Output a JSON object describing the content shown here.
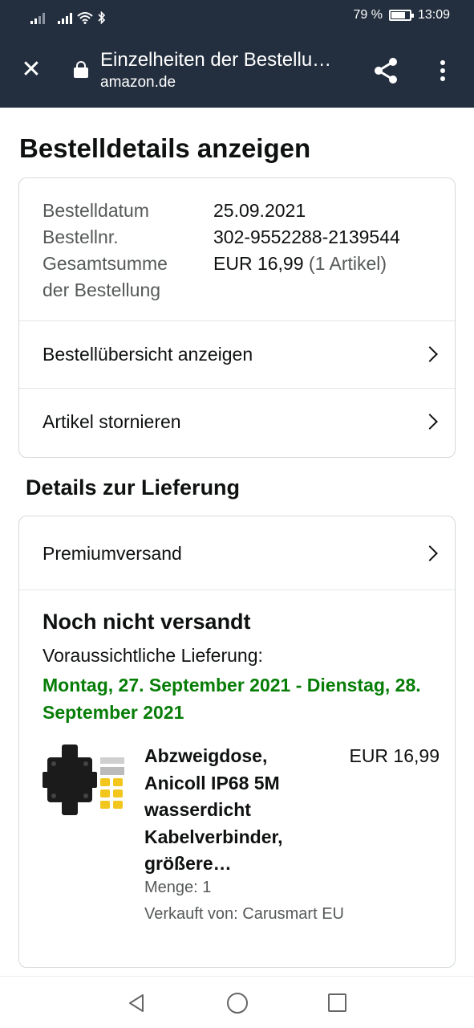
{
  "status_bar": {
    "battery_text": "79 %",
    "battery_level": 0.79,
    "time": "13:09",
    "icons": [
      "signal-icon",
      "signal-icon",
      "wifi-icon",
      "bluetooth-icon",
      "battery-icon"
    ]
  },
  "app_bar": {
    "title": "Einzelheiten der Bestellu…",
    "subtitle": "amazon.de",
    "icons": [
      "close-icon",
      "lock-icon",
      "share-icon",
      "more-vert-icon"
    ]
  },
  "page": {
    "title": "Bestelldetails anzeigen"
  },
  "order_summary": {
    "date_label": "Bestelldatum",
    "date_value": "25.09.2021",
    "number_label": "Bestellnr.",
    "number_value": "302-9552288-2139544",
    "total_label_line1": "Gesamtsumme",
    "total_label_line2": "der Bestellung",
    "total_value": "EUR 16,99",
    "total_items": "(1 Artikel)"
  },
  "order_links": [
    {
      "label": "Bestellübersicht anzeigen",
      "icon": "chevron-right-icon"
    },
    {
      "label": "Artikel stornieren",
      "icon": "chevron-right-icon"
    }
  ],
  "delivery": {
    "section_title": "Details zur Lieferung",
    "shipping_method": "Premiumversand",
    "status": "Noch nicht versandt",
    "estimate_label": "Voraussichtliche Lieferung:",
    "estimate_date": "Montag, 27. September 2021 - Dienstag, 28. September 2021",
    "accent_color": "#067d06"
  },
  "item": {
    "name": "Abzweigdose, Anicoll IP68 5M wasserdicht Kabelverbinder, größere…",
    "price": "EUR 16,99",
    "quantity": "Menge: 1",
    "seller": "Verkauft von: Carusmart EU"
  },
  "nav_bar": {
    "icons": [
      "back-icon",
      "home-icon",
      "recent-apps-icon"
    ]
  },
  "colors": {
    "header_bg": "#232f3e",
    "text": "#0f1111",
    "muted": "#565959"
  }
}
